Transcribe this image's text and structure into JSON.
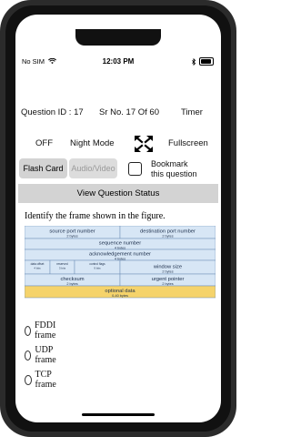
{
  "status": {
    "carrier": "No SIM",
    "time": "12:03 PM"
  },
  "header": {
    "question_id": "Question ID : 17",
    "sr_no": "Sr No. 17 Of 60",
    "timer": "Timer"
  },
  "controls": {
    "night_mode_state": "OFF",
    "night_mode_label": "Night Mode",
    "fullscreen_label": "Fullscreen",
    "fullscreen_icon": "expand-arrows-icon"
  },
  "buttons": {
    "flash_card": "Flash Card",
    "audio_video": "Audio/Video",
    "bookmark_line1": "Bookmark",
    "bookmark_line2": "this question",
    "view_status": "View Question Status"
  },
  "question": {
    "text": "Identify the frame shown in the figure."
  },
  "figure": {
    "colors": {
      "header": "#d7e6f5",
      "border": "#6a8bb5",
      "data": "#f5d36b"
    },
    "rows": [
      {
        "cells": [
          {
            "label": "source port number",
            "sub": "2 bytes"
          },
          {
            "label": "destination port number",
            "sub": "2 bytes"
          }
        ]
      },
      {
        "cells": [
          {
            "label": "sequence number",
            "sub": "4 bytes"
          }
        ]
      },
      {
        "cells": [
          {
            "label": "acknowledgement number",
            "sub": "4 bytes"
          }
        ]
      },
      {
        "cells": [
          {
            "label": "data offset",
            "sub": "4 bits"
          },
          {
            "label": "reserved",
            "sub": "3 bits"
          },
          {
            "label": "control flags",
            "sub": "9 bits"
          },
          {
            "label": "window size",
            "sub": "2 bytes"
          }
        ]
      },
      {
        "cells": [
          {
            "label": "checksum",
            "sub": "2 bytes"
          },
          {
            "label": "urgent pointer",
            "sub": "2 bytes"
          }
        ]
      },
      {
        "cells": [
          {
            "label": "optional data",
            "sub": "0-40 bytes"
          }
        ]
      }
    ]
  },
  "options": [
    {
      "label": "FDDI frame"
    },
    {
      "label": "UDP frame"
    },
    {
      "label": "TCP frame"
    }
  ]
}
